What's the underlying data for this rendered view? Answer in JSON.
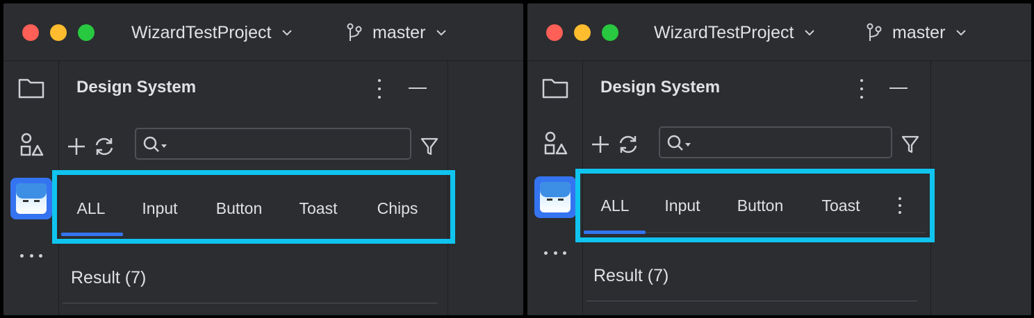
{
  "colors": {
    "accent": "#3574f0",
    "highlight": "#10c4f0",
    "bg": "#2b2d30"
  },
  "left": {
    "project_name": "WizardTestProject",
    "branch": "master",
    "tool_title": "Design System",
    "tabs": [
      {
        "label": "ALL",
        "selected": true
      },
      {
        "label": "Input",
        "selected": false
      },
      {
        "label": "Button",
        "selected": false
      },
      {
        "label": "Toast",
        "selected": false
      },
      {
        "label": "Chips",
        "selected": false
      }
    ],
    "result_label": "Result (7)"
  },
  "right": {
    "project_name": "WizardTestProject",
    "branch": "master",
    "tool_title": "Design System",
    "tabs": [
      {
        "label": "ALL",
        "selected": true
      },
      {
        "label": "Input",
        "selected": false
      },
      {
        "label": "Button",
        "selected": false
      },
      {
        "label": "Toast",
        "selected": false
      }
    ],
    "overflow_icon": "more-vertical-icon",
    "result_label": "Result (7)"
  },
  "icons": [
    "folder-icon",
    "shapes-icon",
    "avatar",
    "more-horizontal-icon",
    "plus-icon",
    "refresh-icon",
    "search-icon",
    "filter-icon",
    "branch-icon",
    "chevron-down-icon",
    "minimize-icon"
  ]
}
